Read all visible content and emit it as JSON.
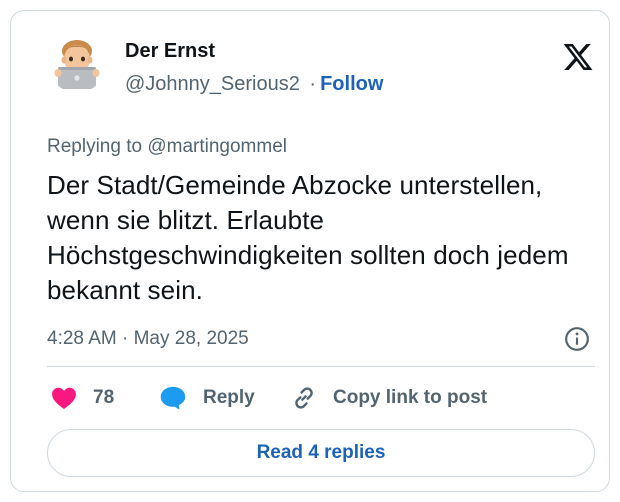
{
  "author": {
    "display_name": "Der Ernst",
    "handle": "@Johnny_Serious2",
    "separator": "·",
    "follow_label": "Follow",
    "avatar_icon": "memoji-laptop-avatar"
  },
  "platform_icon": "x-logo-icon",
  "replying_to": "Replying to @martingommel",
  "tweet_text": "Der Stadt/Gemeinde Abzocke unterstellen, wenn sie blitzt. Erlaubte Höchstgeschwindigkeiten sollten doch jedem bekannt sein.",
  "timestamp": "4:28 AM · May 28, 2025",
  "actions": {
    "like_count": "78",
    "reply_label": "Reply",
    "copy_label": "Copy link to post"
  },
  "read_replies_label": "Read 4 replies",
  "colors": {
    "accent": "#1d62b9",
    "like": "#f91880",
    "reply_bubble": "#1d9bf0",
    "muted_text": "#536471",
    "border": "#cfd9de"
  }
}
